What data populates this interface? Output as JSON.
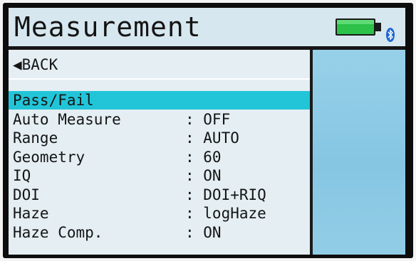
{
  "header": {
    "title": "Measurement",
    "battery_icon": "battery-full-icon",
    "bluetooth_icon": "bluetooth-icon",
    "battery_color": "#2cc24a"
  },
  "nav": {
    "back_icon": "back-arrow-icon",
    "back_label": "◀BACK"
  },
  "menu": {
    "selected_color": "#22c5d8",
    "items": [
      {
        "label": "Pass/Fail",
        "value": ""
      },
      {
        "label": "Auto Measure",
        "value": ": OFF"
      },
      {
        "label": "Range",
        "value": ": AUTO"
      },
      {
        "label": "Geometry",
        "value": ": 60"
      },
      {
        "label": "IQ",
        "value": ": ON"
      },
      {
        "label": "DOI",
        "value": ": DOI+RIQ"
      },
      {
        "label": "Haze",
        "value": ": logHaze"
      },
      {
        "label": "Haze Comp.",
        "value": ": ON"
      }
    ]
  }
}
